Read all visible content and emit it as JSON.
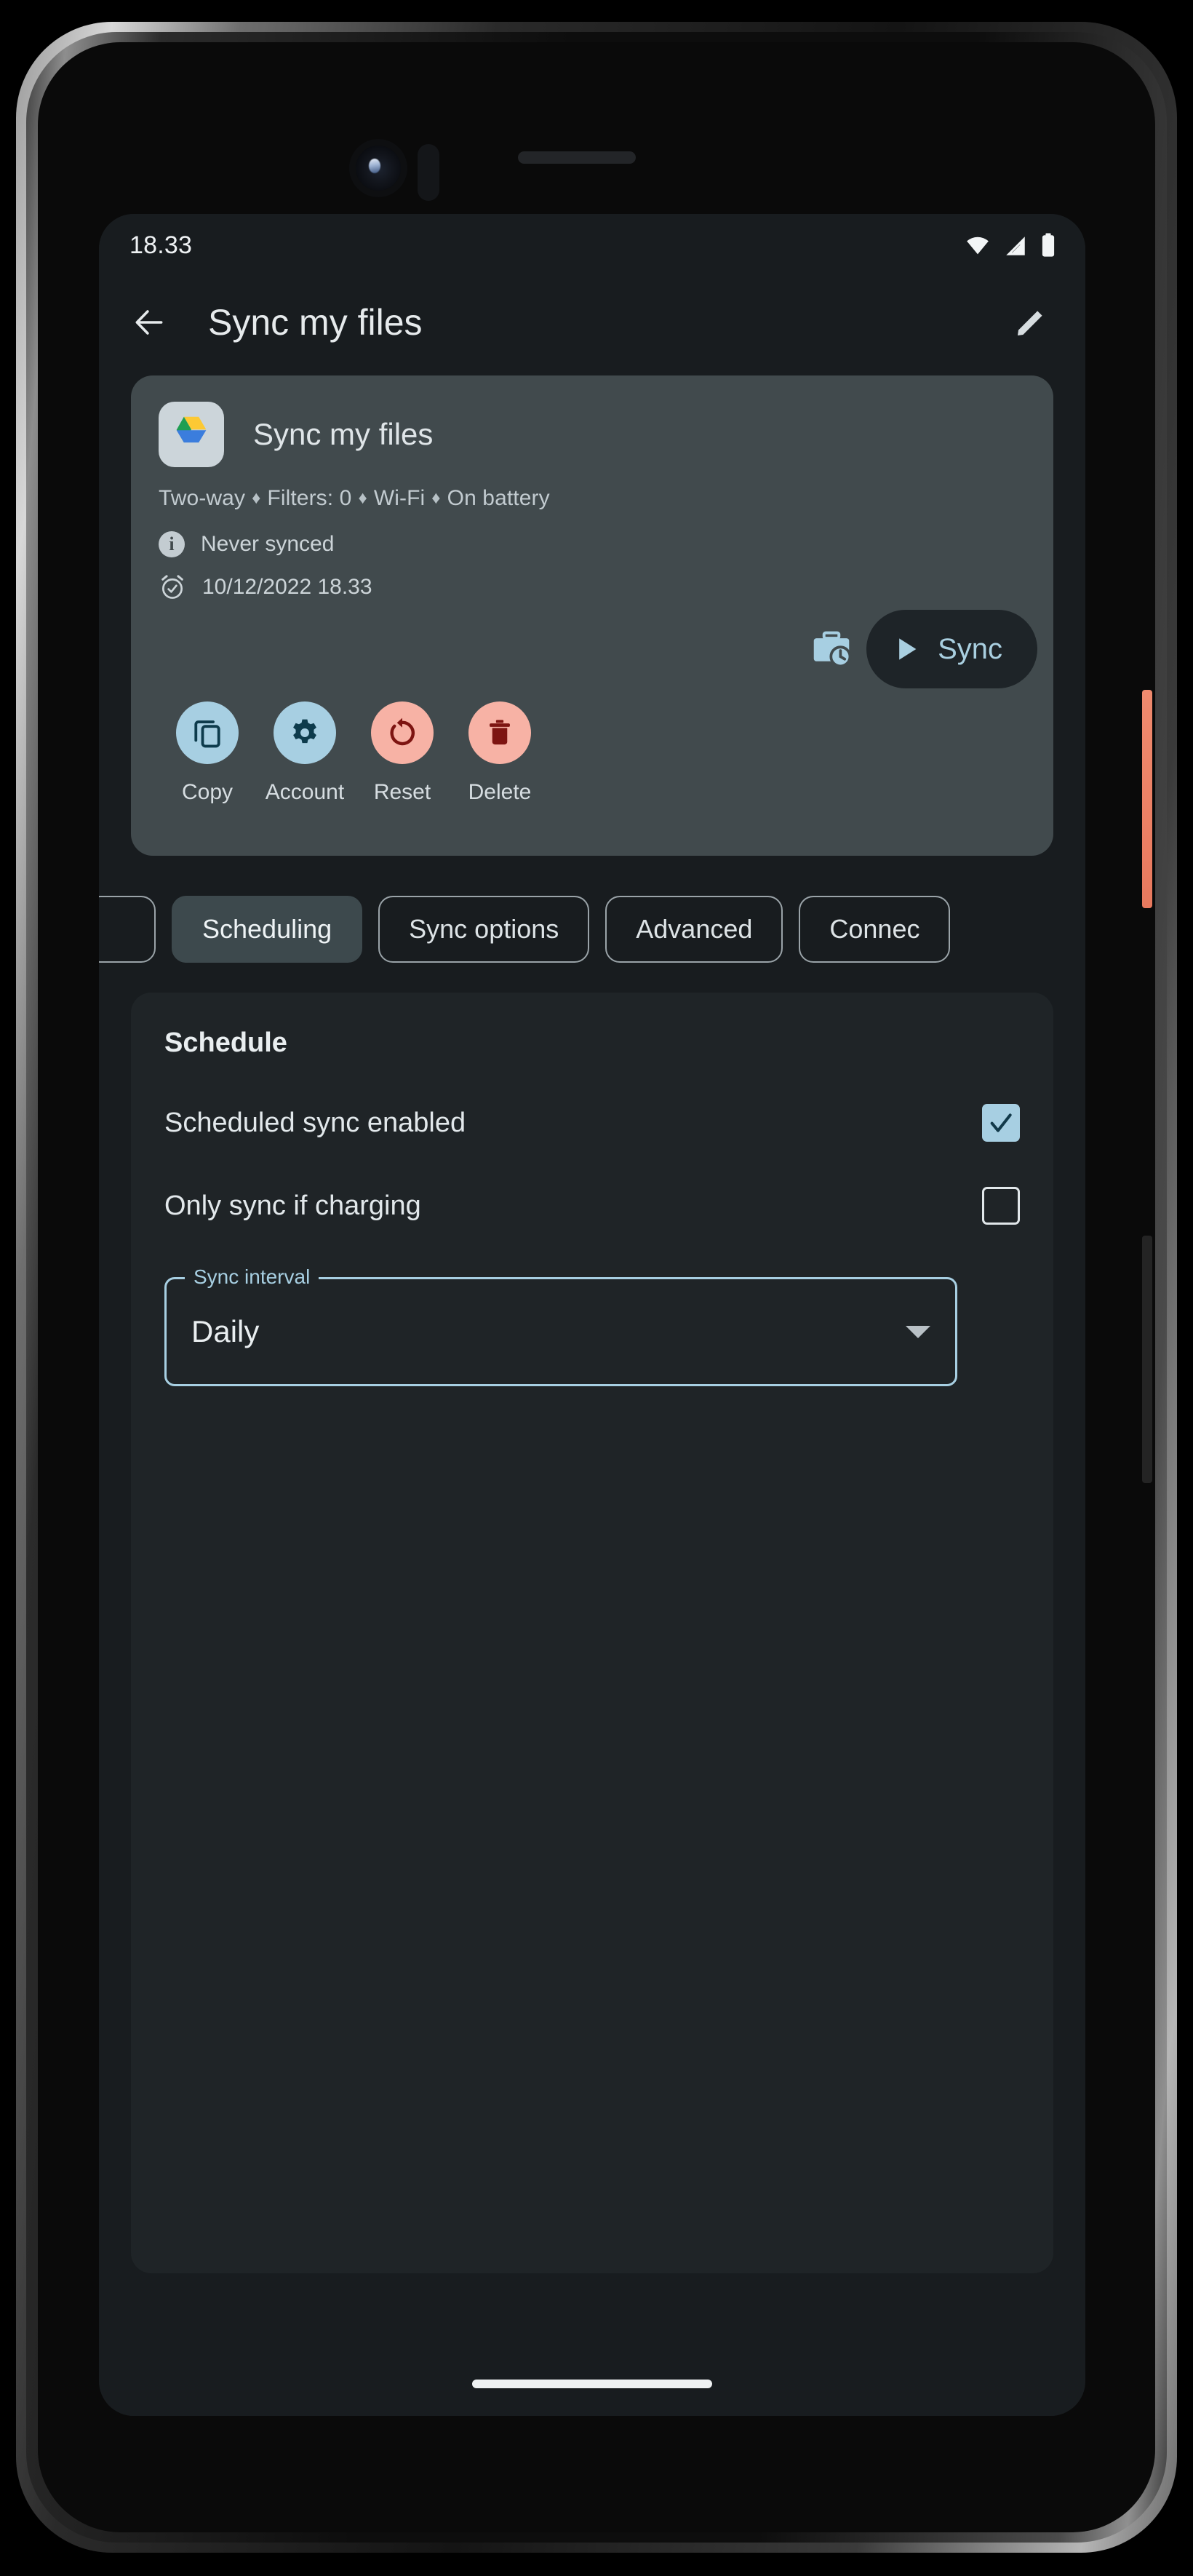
{
  "status_bar": {
    "time": "18.33",
    "icons": [
      "wifi-icon",
      "cellular-signal-icon",
      "battery-icon"
    ]
  },
  "app_bar": {
    "back_icon": "arrow-back-icon",
    "title": "Sync my files",
    "edit_icon": "pencil-edit-icon"
  },
  "folder_pair_card": {
    "account_icon": "google-drive-icon",
    "name": "Sync my files",
    "details": [
      "Two-way",
      "Filters: 0",
      "Wi-Fi",
      "On battery"
    ],
    "separator": "♦",
    "sync_status_icon": "info-icon",
    "sync_status": "Never synced",
    "next_sync_icon": "alarm-clock-icon",
    "next_sync": "10/12/2022 18.33",
    "briefcase_icon": "briefcase-clock-icon",
    "sync_button": {
      "icon": "play-triangle-icon",
      "label": "Sync"
    },
    "actions": [
      {
        "label": "Copy",
        "icon": "copy-icon",
        "bg": "#a7cfe2",
        "fg": "#0d3b4c"
      },
      {
        "label": "Account",
        "icon": "gear-icon",
        "bg": "#a7cfe2",
        "fg": "#0d3b4c"
      },
      {
        "label": "Reset",
        "icon": "reset-icon",
        "bg": "#f7b2a5",
        "fg": "#7d1411"
      },
      {
        "label": "Delete",
        "icon": "trash-icon",
        "bg": "#f7b2a5",
        "fg": "#7d1411"
      }
    ]
  },
  "tabs": [
    {
      "label": "",
      "selected": false,
      "clipped": true
    },
    {
      "label": "Scheduling",
      "selected": true,
      "clipped": false
    },
    {
      "label": "Sync options",
      "selected": false,
      "clipped": false
    },
    {
      "label": "Advanced",
      "selected": false,
      "clipped": false
    },
    {
      "label": "Connec",
      "selected": false,
      "clipped": false
    }
  ],
  "schedule_panel": {
    "heading": "Schedule",
    "options": [
      {
        "label": "Scheduled sync enabled",
        "checked": true
      },
      {
        "label": "Only sync if charging",
        "checked": false
      }
    ],
    "interval_field": {
      "label": "Sync interval",
      "value": "Daily",
      "caret_icon": "chevron-down-icon"
    }
  },
  "colors": {
    "accent": "#a7cfe2",
    "danger": "#f7b2a5",
    "screen_bg": "#181c1f",
    "card_bg": "#414a4d",
    "panel_bg": "#1f2427"
  }
}
